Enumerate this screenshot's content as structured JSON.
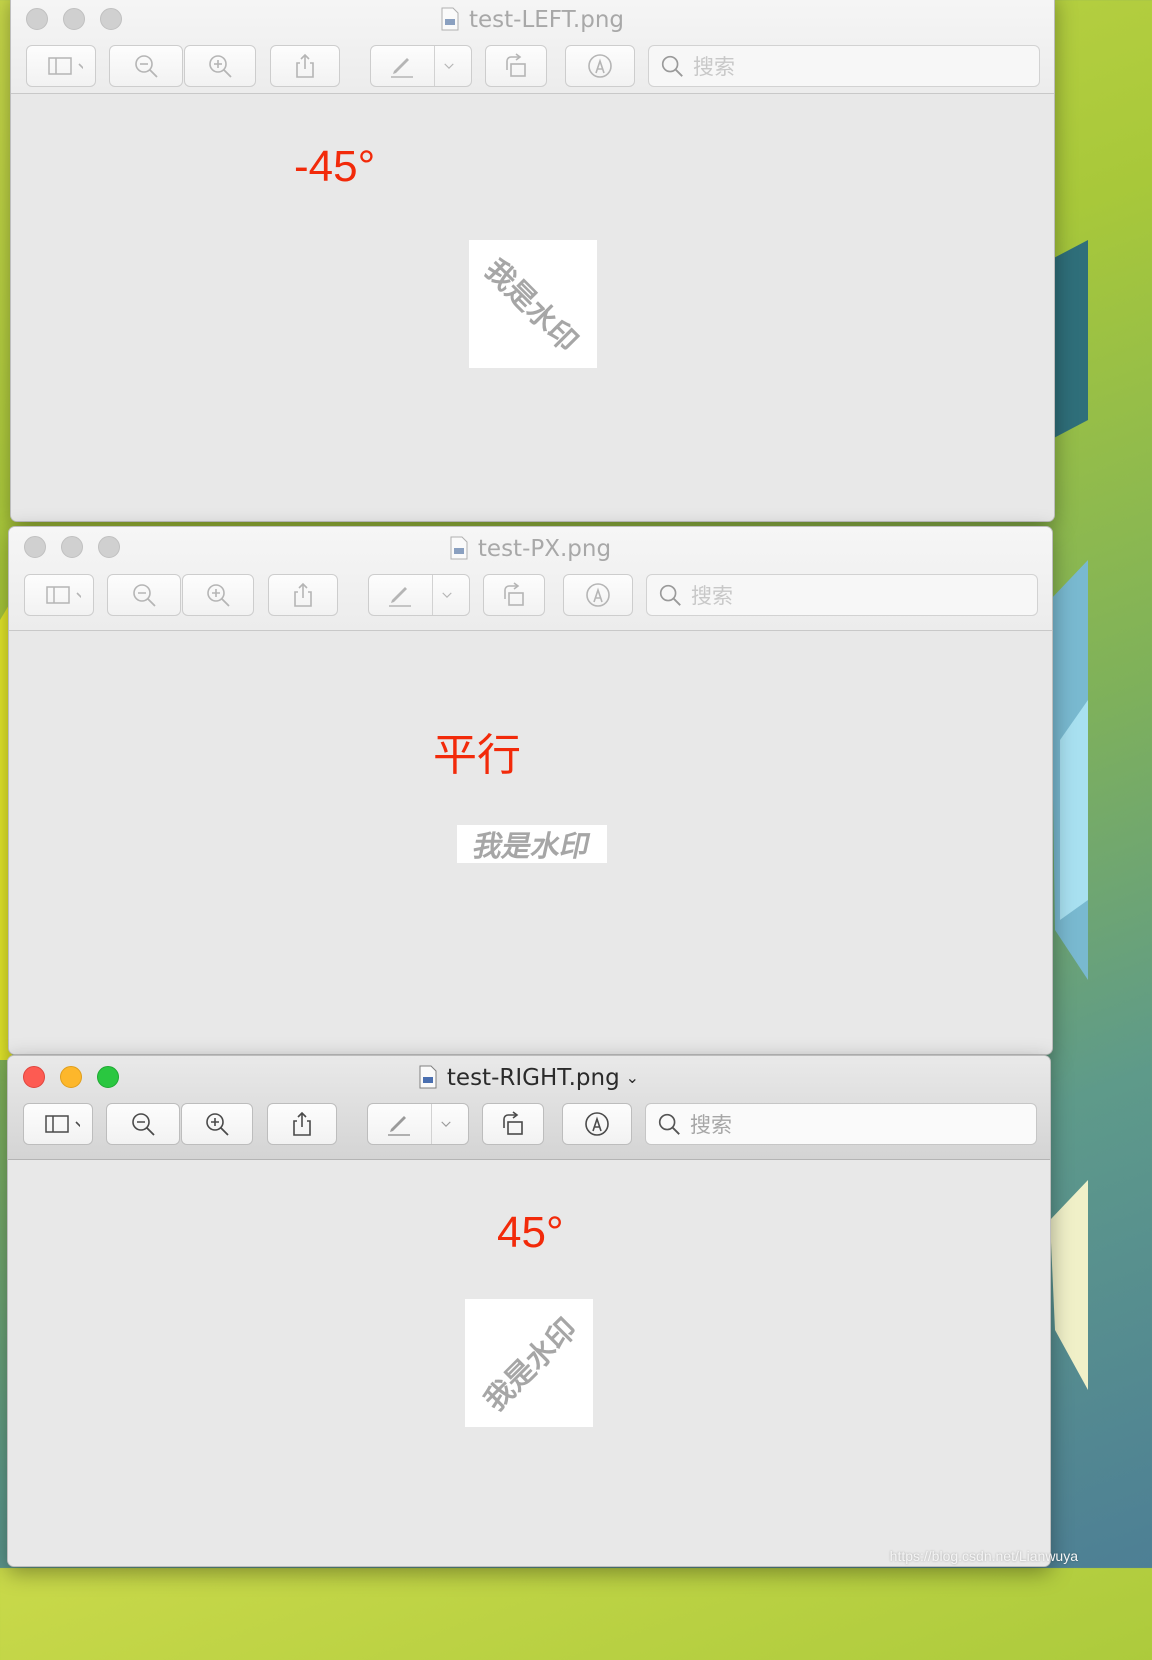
{
  "windows": [
    {
      "title": "test-LEFT.png",
      "active": false,
      "search_placeholder": "搜索",
      "annotation": "-45°",
      "watermark_text": "我是水印",
      "watermark_angle_deg": 45
    },
    {
      "title": "test-PX.png",
      "active": false,
      "search_placeholder": "搜索",
      "annotation": "平行",
      "watermark_text": "我是水印",
      "watermark_angle_deg": 0
    },
    {
      "title": "test-RIGHT.png",
      "active": true,
      "search_placeholder": "搜索",
      "annotation": "45°",
      "watermark_text": "我是水印",
      "watermark_angle_deg": -45
    }
  ],
  "toolbar_icons": [
    "sidebar-icon",
    "zoom-out-icon",
    "zoom-in-icon",
    "share-icon",
    "markup-pen-icon",
    "rotate-icon",
    "markup-toolbar-icon",
    "search-icon"
  ],
  "colors": {
    "annotation": "#f22a0a",
    "watermark": "#a6a6a6",
    "close": "#fd5b52",
    "minimize": "#fdb72b",
    "maximize": "#2ac740"
  },
  "footer": "https://blog.csdn.net/Lianwuya"
}
